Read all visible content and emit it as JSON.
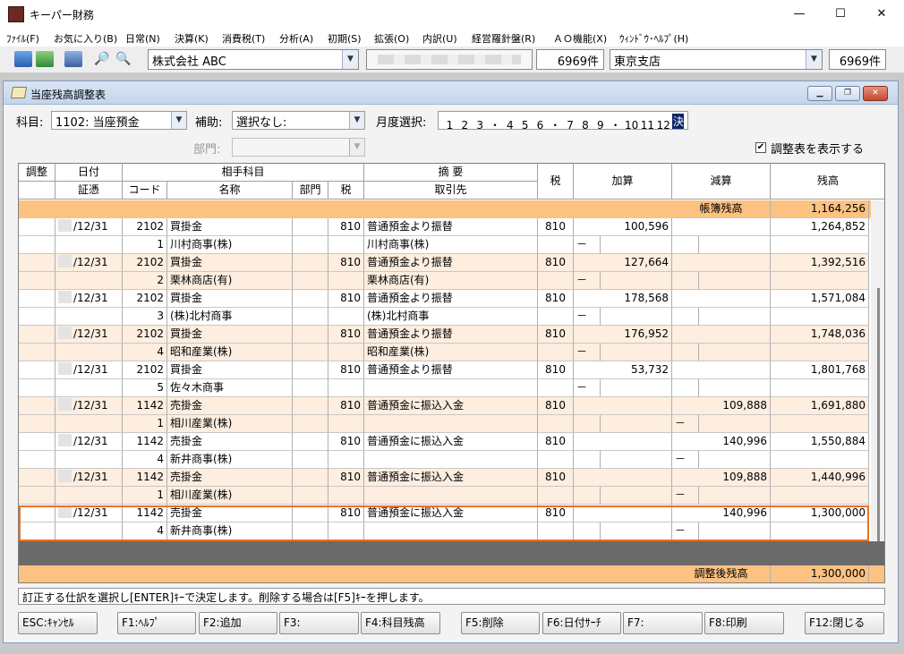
{
  "window": {
    "title": "キーパー財務",
    "minimize": "—",
    "maximize": "☐",
    "close": "✕"
  },
  "menu": [
    "ﾌｧｲﾙ(F)",
    "お気に入り(B)",
    "日常(N)",
    "決算(K)",
    "消費税(T)",
    "分析(A)",
    "初期(S)",
    "拡張(O)",
    "内訳(U)",
    "経営羅針盤(R)",
    "ＡＯ機能(X)",
    "ｳｨﾝﾄﾞｳ･ﾍﾙﾌﾟ(H)"
  ],
  "toolbar": {
    "company": "株式会社 ABC",
    "count1": "6969件",
    "branch": "東京支店",
    "count2": "6969件"
  },
  "child": {
    "title": "当座残高調整表",
    "subject_label": "科目:",
    "subject_value": "1102: 当座預金",
    "aux_label": "補助:",
    "aux_value": "選択なし:",
    "dept_label": "部門:",
    "dept_value": "",
    "month_label": "月度選択:",
    "months": [
      "1",
      "2",
      "3",
      "・",
      "4",
      "5",
      "6",
      "・",
      "7",
      "8",
      "9",
      "・",
      "10",
      "11",
      "12",
      "決"
    ],
    "month_selected_index": 15,
    "show_table_label": "調整表を表示する",
    "show_table_checked": true,
    "check_mark": "✔"
  },
  "grid": {
    "headers": {
      "adj": "調整",
      "date": "日付",
      "counter": "相手科目",
      "summary": "摘 要",
      "tax": "税",
      "add": "加算",
      "sub": "減算",
      "balance": "残高",
      "voucher": "証憑",
      "code": "コード",
      "name": "名称",
      "dept": "部門",
      "tax2": "税",
      "partner": "取引先"
    },
    "book_label": "帳簿残高",
    "book_balance": "1,164,256",
    "rows": [
      {
        "date": "/12/31",
        "code": "2102",
        "name": "買掛金",
        "tax": "810",
        "summary": "普通預金より振替",
        "tax2": "810",
        "add": "100,596",
        "sub": "",
        "balance": "1,264,852",
        "subcode": "1",
        "partner_name": "川村商事(株)",
        "partner": "川村商事(株)",
        "mark": "－",
        "mark_col": "add"
      },
      {
        "date": "/12/31",
        "code": "2102",
        "name": "買掛金",
        "tax": "810",
        "summary": "普通預金より振替",
        "tax2": "810",
        "add": "127,664",
        "sub": "",
        "balance": "1,392,516",
        "subcode": "2",
        "partner_name": "栗林商店(有)",
        "partner": "栗林商店(有)",
        "mark": "－",
        "mark_col": "add"
      },
      {
        "date": "/12/31",
        "code": "2102",
        "name": "買掛金",
        "tax": "810",
        "summary": "普通預金より振替",
        "tax2": "810",
        "add": "178,568",
        "sub": "",
        "balance": "1,571,084",
        "subcode": "3",
        "partner_name": "(株)北村商事",
        "partner": "(株)北村商事",
        "mark": "－",
        "mark_col": "add"
      },
      {
        "date": "/12/31",
        "code": "2102",
        "name": "買掛金",
        "tax": "810",
        "summary": "普通預金より振替",
        "tax2": "810",
        "add": "176,952",
        "sub": "",
        "balance": "1,748,036",
        "subcode": "4",
        "partner_name": "昭和産業(株)",
        "partner": "昭和産業(株)",
        "mark": "－",
        "mark_col": "add"
      },
      {
        "date": "/12/31",
        "code": "2102",
        "name": "買掛金",
        "tax": "810",
        "summary": "普通預金より振替",
        "tax2": "810",
        "add": "53,732",
        "sub": "",
        "balance": "1,801,768",
        "subcode": "5",
        "partner_name": "佐々木商事",
        "partner": "",
        "mark": "－",
        "mark_col": "add"
      },
      {
        "date": "/12/31",
        "code": "1142",
        "name": "売掛金",
        "tax": "810",
        "summary": "普通預金に振込入金",
        "tax2": "810",
        "add": "",
        "sub": "109,888",
        "balance": "1,691,880",
        "subcode": "1",
        "partner_name": "相川産業(株)",
        "partner": "",
        "mark": "－",
        "mark_col": "sub"
      },
      {
        "date": "/12/31",
        "code": "1142",
        "name": "売掛金",
        "tax": "810",
        "summary": "普通預金に振込入金",
        "tax2": "810",
        "add": "",
        "sub": "140,996",
        "balance": "1,550,884",
        "subcode": "4",
        "partner_name": "新井商事(株)",
        "partner": "",
        "mark": "－",
        "mark_col": "sub"
      },
      {
        "date": "/12/31",
        "code": "1142",
        "name": "売掛金",
        "tax": "810",
        "summary": "普通預金に振込入金",
        "tax2": "810",
        "add": "",
        "sub": "109,888",
        "balance": "1,440,996",
        "subcode": "1",
        "partner_name": "相川産業(株)",
        "partner": "",
        "mark": "－",
        "mark_col": "sub"
      },
      {
        "date": "/12/31",
        "code": "1142",
        "name": "売掛金",
        "tax": "810",
        "summary": "普通預金に振込入金",
        "tax2": "810",
        "add": "",
        "sub": "140,996",
        "balance": "1,300,000",
        "subcode": "4",
        "partner_name": "新井商事(株)",
        "partner": "",
        "mark": "－",
        "mark_col": "sub"
      }
    ],
    "selected_row": 8,
    "adjusted_label": "調整後残高",
    "adjusted_balance": "1,300,000"
  },
  "status_message": "訂正する仕訳を選択し[ENTER]ｷｰで決定します。削除する場合は[F5]ｷｰを押します。",
  "fkeys": [
    "ESC:ｷｬﾝｾﾙ",
    "F1:ﾍﾙﾌﾟ",
    "F2:追加",
    "F3:",
    "F4:科目残高",
    "F5:削除",
    "F6:日付ｻｰﾁ",
    "F7:",
    "F8:印刷",
    "F12:閉じる"
  ],
  "colors": {
    "selection_border": "#f07020",
    "row_alt": "#fdeee0",
    "summary_band": "#fcc282",
    "month_selected": "#0a246a"
  }
}
